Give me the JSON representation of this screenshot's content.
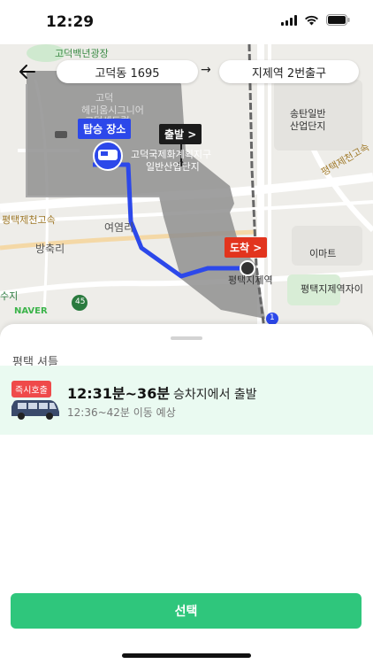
{
  "status": {
    "time": "12:29"
  },
  "route": {
    "origin": "고덕동 1695",
    "arrow": "→",
    "destination": "지제역 2번출구"
  },
  "map": {
    "labels": {
      "park": "고덕백년광장",
      "building1": "고덕",
      "building2": "헤리움시그니어",
      "building3": "고덕센트럴",
      "industrial": "송탄일반",
      "industrial2": "산업단지",
      "station_area": "평택지제역",
      "station_sub": "평택지제역자이",
      "yeoyeom": "여염리",
      "bangchuk": "방축리",
      "highway": "평택제천고속",
      "highway2": "평택제천고속",
      "emart": "이마트",
      "industrial_plan": "고덕국제화계획지구",
      "industrial_plan2": "일반산업단지",
      "route_num": "45",
      "route_num2": "1",
      "left_edge": "수지",
      "naver": "NAVER"
    },
    "tags": {
      "pickup": "탑승 장소",
      "departure": "출발 >",
      "arrival": "도착 >"
    }
  },
  "sheet": {
    "section_title": "평택 셔틀",
    "option": {
      "badge": "즉시호출",
      "time_main": "12:31분~36분",
      "time_main_suffix": "승차지에서 출발",
      "time_sub": "12:36~42분 이동 예상"
    }
  },
  "select_button": "선택",
  "colors": {
    "accent": "#2fc67c",
    "route": "#2c48ea",
    "badge": "#ef4a4a",
    "option_bg": "#eafaf1"
  }
}
